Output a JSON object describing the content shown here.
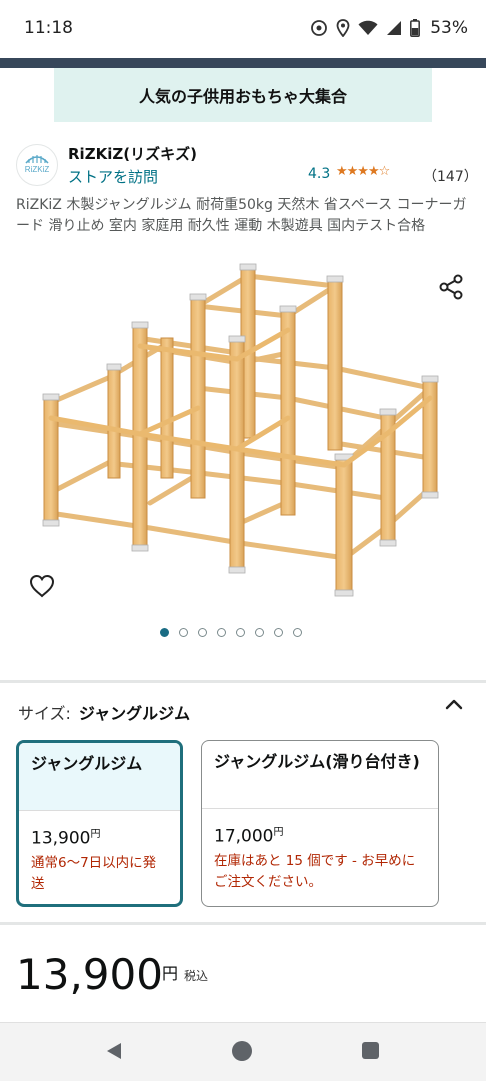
{
  "status_bar": {
    "time": "11:18",
    "battery_percent": "53%",
    "icons": [
      "sync-icon",
      "location-icon",
      "wifi-icon",
      "signal-icon",
      "battery-icon"
    ]
  },
  "banner": {
    "text": "人気の子供用おもちゃ大集合"
  },
  "store": {
    "logo_text": "RiZKiZ",
    "brand": "RiZKiZ(リズキズ)",
    "visit_link": "ストアを訪問",
    "rating": "4.3",
    "stars": "★★★★☆",
    "review_count": "（147）"
  },
  "product": {
    "title": "RiZKiZ 木製ジャングルジム 耐荷重50kg 天然木 省スペース コーナーガード 滑り止め 室内 家庭用 耐久性 運動 木製遊具 国内テスト合格",
    "image_count": 8,
    "active_image": 1
  },
  "size_selector": {
    "label": "サイズ:",
    "selected": "ジャングルジム",
    "options": [
      {
        "name": "ジャングルジム",
        "price": "13,900",
        "currency": "円",
        "note": "通常6〜7日以内に発送",
        "selected": true
      },
      {
        "name": "ジャングルジム(滑り台付き)",
        "price": "17,000",
        "currency": "円",
        "note": "在庫はあと 15 個です - お早めにご注文ください。",
        "selected": false
      }
    ]
  },
  "price": {
    "amount": "13,900",
    "currency": "円",
    "tax": "税込"
  },
  "nav": {
    "icons": [
      "back-icon",
      "home-icon",
      "recents-icon"
    ]
  },
  "colors": {
    "link": "#007185",
    "accent": "#1f6f7c",
    "star": "#de7921",
    "warning": "#b12704",
    "header": "#37475a",
    "banner": "#dff2ef"
  }
}
